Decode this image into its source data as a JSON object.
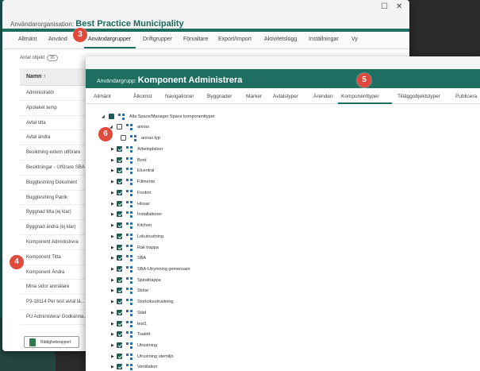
{
  "outer": {
    "org_label": "Användarorganisation:",
    "org_name": "Best Practice Municipality",
    "tabs": [
      "Allmänt",
      "Använd",
      "Användargrupper",
      "Driftgrupper",
      "Förvaltare",
      "Export/Import",
      "Aktivitetslogg",
      "Inställningar",
      "Vy"
    ],
    "count_label": "Antal objekt",
    "count": "26",
    "list_header": "Namn ↑",
    "list": [
      "Administratör",
      "Apoteket temp",
      "Avtal titta",
      "Avtal ändra",
      "Besiktning extern utförare",
      "Besiktningar - Utförare SBA",
      "Buggtestning Dokument",
      "Buggtestning Patrik",
      "Byggnad titta (ej klar)",
      "Byggnad ändra (ej klar)",
      "Komponent Administrera",
      "Komponent Titta",
      "Komponent Ändra",
      "Mina sidor anmälare",
      "P3-18114 Per test avtal lä...",
      "PU Administera/ Godkänna..."
    ],
    "report_button": "Rättighetsrapport"
  },
  "inner": {
    "group_label": "Användargrupp:",
    "group_name": "Komponent Administrera",
    "tabs": [
      "Allmänt",
      "Åtkomst",
      "Navigationer",
      "Byggnader",
      "Marker",
      "Avtalstyper",
      "Ärenden",
      "Komponenttyper",
      "Tilläggobjektstyper",
      "Publicera"
    ],
    "tree_root": "Alla Space/Manager Space komponenttyper",
    "tree_child_group": "annas",
    "tree_grandchild": "annas typ",
    "tree_items": [
      "Arbetsplatser",
      "Bord",
      "Elcentral",
      "Fillmento",
      "Fordon",
      "Hissar",
      "Installationer",
      "Kitchen",
      "Lokutrustning",
      "Rak trappa",
      "SBA",
      "SBA-Utrymning gemensam",
      "Spiraltrappa",
      "Stolar",
      "Storköksutrustning",
      "Städ",
      "test1",
      "Toalett",
      "Utrustning",
      "Utrustning utemiljö",
      "Ventilation"
    ]
  },
  "badges": [
    "3",
    "4",
    "5",
    "6"
  ]
}
